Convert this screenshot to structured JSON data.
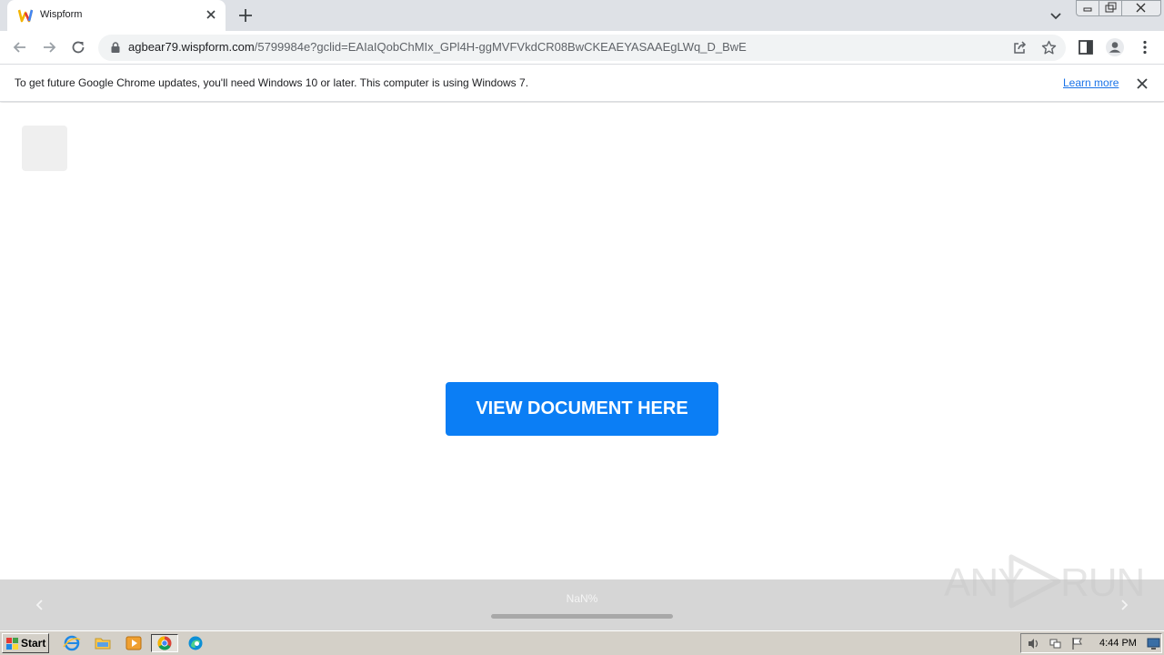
{
  "browser": {
    "tab": {
      "title": "Wispform",
      "favicon": "wispform-w-icon"
    },
    "url": {
      "host": "agbear79.wispform.com",
      "path": "/5799984e?gclid=EAIaIQobChMIx_GPl4H-ggMVFVkdCR08BwCKEAEYASAAEgLWq_D_BwE"
    }
  },
  "infobar": {
    "message": "To get future Google Chrome updates, you'll need Windows 10 or later. This computer is using Windows 7.",
    "link": "Learn more"
  },
  "page": {
    "cta_label": "VIEW DOCUMENT HERE",
    "progress_label": "NaN%"
  },
  "watermark": {
    "left": "ANY",
    "right": "RUN"
  },
  "taskbar": {
    "start_label": "Start",
    "clock": "4:44 PM"
  },
  "colors": {
    "cta": "#0b7ef5",
    "link": "#1a73e8",
    "tabstrip": "#dee1e6",
    "progress_bg": "#d6d6d6"
  }
}
